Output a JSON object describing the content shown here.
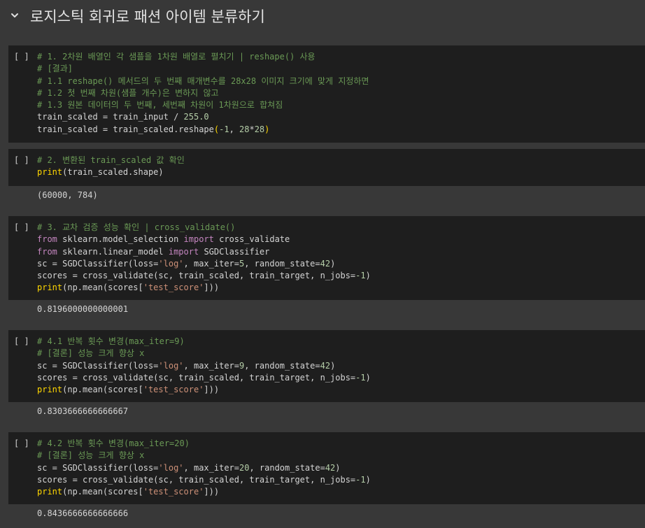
{
  "section": {
    "title": "로지스틱 회귀로 패션 아이템 분류하기",
    "toggle_icon": "chevron-down-icon"
  },
  "run_label": "[ ]",
  "cells": [
    {
      "code": [
        [
          {
            "t": "# 1. 2차원 배열인 각 샘플을 1차원 배열로 펼치기 | reshape() 사용",
            "c": "c"
          }
        ],
        [
          {
            "t": "# [결과]",
            "c": "c"
          }
        ],
        [
          {
            "t": "# 1.1 reshape() 메서드의 두 번째 매개변수를 28x28 이미지 크기에 맞게 지정하면",
            "c": "c"
          }
        ],
        [
          {
            "t": "# 1.2 첫 번째 차원(샘플 개수)은 변하지 않고",
            "c": "c"
          }
        ],
        [
          {
            "t": "# 1.3 원본 데이터의 두 번째, 세번째 차원이 1차원으로 합쳐짐",
            "c": "c"
          }
        ],
        [
          {
            "t": "train_scaled = train_input / ",
            "c": ""
          },
          {
            "t": "255.0",
            "c": "n"
          }
        ],
        [
          {
            "t": "train_scaled = train_scaled.reshape",
            "c": ""
          },
          {
            "t": "(",
            "c": "p"
          },
          {
            "t": "-1",
            "c": "n"
          },
          {
            "t": ", ",
            "c": ""
          },
          {
            "t": "28",
            "c": "n"
          },
          {
            "t": "*",
            "c": ""
          },
          {
            "t": "28",
            "c": "n"
          },
          {
            "t": ")",
            "c": "p"
          }
        ]
      ],
      "output": ""
    },
    {
      "code": [
        [
          {
            "t": "# 2. 변환된 train_scaled 값 확인",
            "c": "c"
          }
        ],
        [
          {
            "t": "print",
            "c": "p"
          },
          {
            "t": "(train_scaled.shape)",
            "c": ""
          }
        ]
      ],
      "output": "(60000, 784)"
    },
    {
      "code": [
        [
          {
            "t": "# 3. 교차 검증 성능 확인 | cross_validate()",
            "c": "c"
          }
        ],
        [
          {
            "t": "from",
            "c": "k"
          },
          {
            "t": " sklearn.model_selection ",
            "c": ""
          },
          {
            "t": "import",
            "c": "k"
          },
          {
            "t": " cross_validate",
            "c": ""
          }
        ],
        [
          {
            "t": "from",
            "c": "k"
          },
          {
            "t": " sklearn.linear_model ",
            "c": ""
          },
          {
            "t": "import",
            "c": "k"
          },
          {
            "t": " SGDClassifier",
            "c": ""
          }
        ],
        [
          {
            "t": "sc = SGDClassifier(loss=",
            "c": ""
          },
          {
            "t": "'log'",
            "c": "s"
          },
          {
            "t": ", max_iter=",
            "c": ""
          },
          {
            "t": "5",
            "c": "n"
          },
          {
            "t": ", random_state=",
            "c": ""
          },
          {
            "t": "42",
            "c": "n"
          },
          {
            "t": ")",
            "c": ""
          }
        ],
        [
          {
            "t": "scores = cross_validate(sc, train_scaled, train_target, n_jobs=",
            "c": ""
          },
          {
            "t": "-1",
            "c": "n"
          },
          {
            "t": ")",
            "c": ""
          }
        ],
        [
          {
            "t": "print",
            "c": "p"
          },
          {
            "t": "(np.mean(scores[",
            "c": ""
          },
          {
            "t": "'test_score'",
            "c": "s"
          },
          {
            "t": "]))",
            "c": ""
          }
        ]
      ],
      "output": "0.8196000000000001"
    },
    {
      "code": [
        [
          {
            "t": "# 4.1 반복 횟수 변경(max_iter=9)",
            "c": "c"
          }
        ],
        [
          {
            "t": "# [결론] 성능 크게 향상 x",
            "c": "c"
          }
        ],
        [
          {
            "t": "sc = SGDClassifier(loss=",
            "c": ""
          },
          {
            "t": "'log'",
            "c": "s"
          },
          {
            "t": ", max_iter=",
            "c": ""
          },
          {
            "t": "9",
            "c": "n"
          },
          {
            "t": ", random_state=",
            "c": ""
          },
          {
            "t": "42",
            "c": "n"
          },
          {
            "t": ")",
            "c": ""
          }
        ],
        [
          {
            "t": "scores = cross_validate(sc, train_scaled, train_target, n_jobs=",
            "c": ""
          },
          {
            "t": "-1",
            "c": "n"
          },
          {
            "t": ")",
            "c": ""
          }
        ],
        [
          {
            "t": "print",
            "c": "p"
          },
          {
            "t": "(np.mean(scores[",
            "c": ""
          },
          {
            "t": "'test_score'",
            "c": "s"
          },
          {
            "t": "]))",
            "c": ""
          }
        ]
      ],
      "output": "0.8303666666666667"
    },
    {
      "code": [
        [
          {
            "t": "# 4.2 반복 횟수 변경(max_iter=20)",
            "c": "c"
          }
        ],
        [
          {
            "t": "# [결론] 성능 크게 향상 x",
            "c": "c"
          }
        ],
        [
          {
            "t": "sc = SGDClassifier(loss=",
            "c": ""
          },
          {
            "t": "'log'",
            "c": "s"
          },
          {
            "t": ", max_iter=",
            "c": ""
          },
          {
            "t": "20",
            "c": "n"
          },
          {
            "t": ", random_state=",
            "c": ""
          },
          {
            "t": "42",
            "c": "n"
          },
          {
            "t": ")",
            "c": ""
          }
        ],
        [
          {
            "t": "scores = cross_validate(sc, train_scaled, train_target, n_jobs=",
            "c": ""
          },
          {
            "t": "-1",
            "c": "n"
          },
          {
            "t": ")",
            "c": ""
          }
        ],
        [
          {
            "t": "print",
            "c": "p"
          },
          {
            "t": "(np.mean(scores[",
            "c": ""
          },
          {
            "t": "'test_score'",
            "c": "s"
          },
          {
            "t": "]))",
            "c": ""
          }
        ]
      ],
      "output": "0.8436666666666666"
    }
  ],
  "colors": {
    "background": "#383838",
    "cell_background": "#1e1e1e",
    "comment": "#6a9955",
    "keyword": "#c586c0",
    "string": "#ce9178",
    "number": "#b5cea8"
  }
}
